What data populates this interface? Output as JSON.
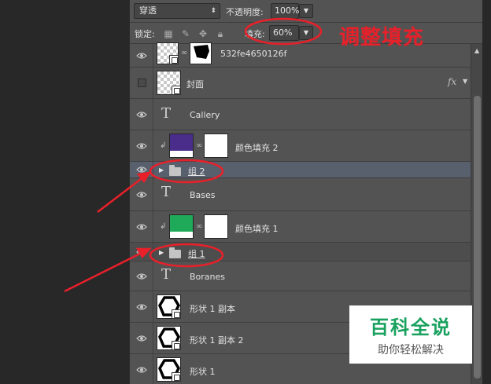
{
  "toolbar": {
    "blend_mode": "穿透",
    "opacity_label": "不透明度:",
    "opacity_value": "100%",
    "lock_label": "锁定:",
    "fill_label": "填充:",
    "fill_value": "60%"
  },
  "icons": {
    "eye": "eye-icon",
    "lock_transparent": "checkerboard-lock-icon",
    "lock_paint": "brush-lock-icon",
    "lock_move": "move-lock-icon",
    "lock_all": "padlock-icon",
    "dropdown": "chevron-down-icon",
    "folder": "folder-icon",
    "text_layer": "type-T-icon",
    "link": "chain-link-icon",
    "fx": "fx-icon"
  },
  "layers": [
    {
      "name": "532fe4650126f",
      "type": "smart-masked",
      "visible": true
    },
    {
      "name": "封面",
      "type": "smart",
      "visible": false,
      "fx": "fx"
    },
    {
      "name": "Callery",
      "type": "text",
      "visible": true
    },
    {
      "name": "颜色填充 2",
      "type": "fill",
      "visible": true,
      "color": "#4a2d8b"
    },
    {
      "name": "组 2",
      "type": "group",
      "visible": true,
      "selected": true
    },
    {
      "name": "Bases",
      "type": "text",
      "visible": true
    },
    {
      "name": "颜色填充 1",
      "type": "fill",
      "visible": true,
      "color": "#1eaa58"
    },
    {
      "name": "组 1",
      "type": "group",
      "visible": true
    },
    {
      "name": "Boranes",
      "type": "text",
      "visible": true
    },
    {
      "name": "形状 1 副本",
      "type": "shape",
      "visible": true
    },
    {
      "name": "形状 1 副本 2",
      "type": "shape",
      "visible": true
    },
    {
      "name": "形状 1",
      "type": "shape",
      "visible": true
    }
  ],
  "annotation": {
    "text": "调整填充",
    "color": "#e8202a"
  },
  "watermark": {
    "title": "百科全说",
    "subtitle": "助你轻松解决",
    "color": "#19a15f"
  }
}
